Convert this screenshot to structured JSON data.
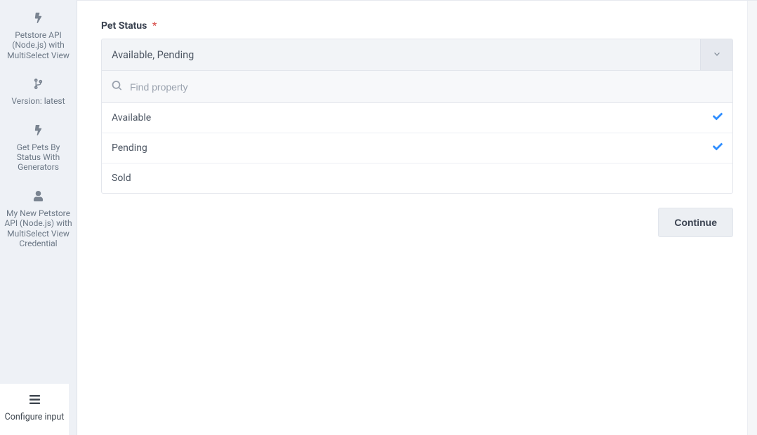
{
  "sidebar": {
    "items": [
      {
        "icon": "bolt-icon",
        "label": "Petstore API (Node.js) with MultiSelect View"
      },
      {
        "icon": "branch-icon",
        "label": "Version: latest"
      },
      {
        "icon": "bolt-icon",
        "label": "Get Pets By Status With Generators"
      },
      {
        "icon": "user-icon",
        "label": "My New Petstore API (Node.js) with MultiSelect View Credential"
      }
    ],
    "active_tab": {
      "icon": "menu-icon",
      "label": "Configure input"
    }
  },
  "form": {
    "field_label": "Pet Status",
    "required_marker": "*",
    "selected_display": "Available, Pending",
    "search_placeholder": "Find property",
    "options": [
      {
        "label": "Available",
        "selected": true
      },
      {
        "label": "Pending",
        "selected": true
      },
      {
        "label": "Sold",
        "selected": false
      }
    ],
    "continue_label": "Continue"
  }
}
